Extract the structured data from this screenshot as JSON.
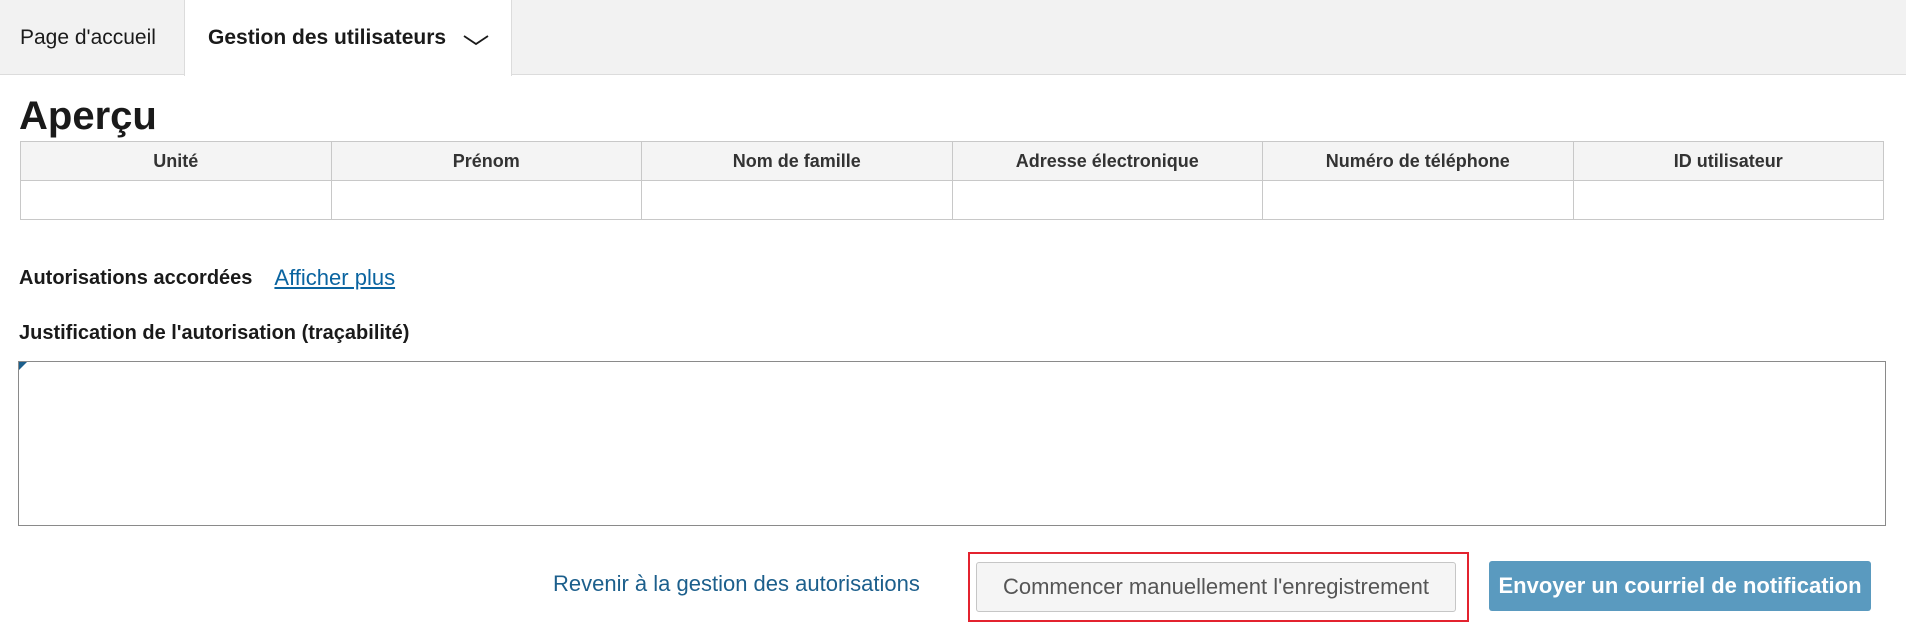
{
  "nav": {
    "home_label": "Page d'accueil",
    "users_label": "Gestion des utilisateurs"
  },
  "page": {
    "title": "Aperçu"
  },
  "table": {
    "headers": [
      "Unité",
      "Prénom",
      "Nom de famille",
      "Adresse électronique",
      "Numéro de téléphone",
      "ID utilisateur"
    ],
    "rows": [
      [
        "",
        "",
        "",
        "",
        "",
        ""
      ]
    ]
  },
  "permissions": {
    "label": "Autorisations accordées",
    "show_more": "Afficher plus"
  },
  "justification": {
    "label": "Justification de l'autorisation (traçabilité)",
    "value": ""
  },
  "actions": {
    "back_link": "Revenir à la gestion des autorisations",
    "manual_start": "Commencer manuellement l'enregistrement",
    "send_notification": "Envoyer un courriel de notification"
  },
  "colors": {
    "accent": "#5a9abf",
    "link": "#1c5f8c",
    "highlight": "#e3232f"
  }
}
